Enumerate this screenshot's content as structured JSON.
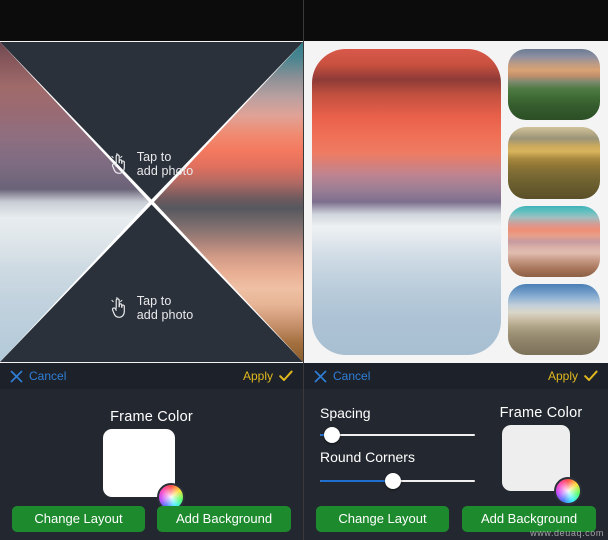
{
  "left_panel": {
    "collage": {
      "layout_name": "x-split-four-triangle",
      "placeholders": [
        {
          "line1": "Tap to",
          "line2": "add photo",
          "icon": "tap-hand-icon"
        },
        {
          "line1": "Tap to",
          "line2": "add photo",
          "icon": "tap-hand-icon"
        }
      ],
      "placeholder_bg": "#2b313b",
      "frame_color": "#ffffff"
    },
    "toolbar": {
      "cancel_label": "Cancel",
      "cancel_icon": "close-x-icon",
      "cancel_color": "#2f7fd8",
      "apply_label": "Apply",
      "apply_icon": "checkmark-icon",
      "apply_color": "#e0b81e"
    },
    "controls": {
      "frame_color_title": "Frame Color",
      "frame_color_value": "#ffffff",
      "color_wheel_icon": "color-wheel-icon",
      "change_layout_label": "Change Layout",
      "add_background_label": "Add Background",
      "button_color": "#1e8a2e"
    }
  },
  "right_panel": {
    "collage": {
      "layout_name": "one-large-four-thumbs",
      "frame_color": "#f4f4f4",
      "tiles": [
        {
          "name": "red-sky-over-ice-lake",
          "role": "large"
        },
        {
          "name": "abandoned-boat-in-green-field",
          "role": "thumb"
        },
        {
          "name": "golden-rocky-hills",
          "role": "thumb"
        },
        {
          "name": "stone-arch-beach-sunset",
          "role": "thumb"
        },
        {
          "name": "railroad-tracks-to-horizon",
          "role": "thumb"
        }
      ]
    },
    "toolbar": {
      "cancel_label": "Cancel",
      "cancel_icon": "close-x-icon",
      "cancel_color": "#2f7fd8",
      "apply_label": "Apply",
      "apply_icon": "checkmark-icon",
      "apply_color": "#e0b81e"
    },
    "controls": {
      "spacing_label": "Spacing",
      "spacing_value": 3,
      "round_corners_label": "Round Corners",
      "round_corners_value": 47,
      "frame_color_title": "Frame Color",
      "frame_color_value": "#eeeeee",
      "color_wheel_icon": "color-wheel-icon",
      "change_layout_label": "Change Layout",
      "add_background_label": "Add Background",
      "button_color": "#1e8a2e",
      "slider_fill_color": "#1f6fd0"
    }
  },
  "watermark": "www.deuaq.com"
}
